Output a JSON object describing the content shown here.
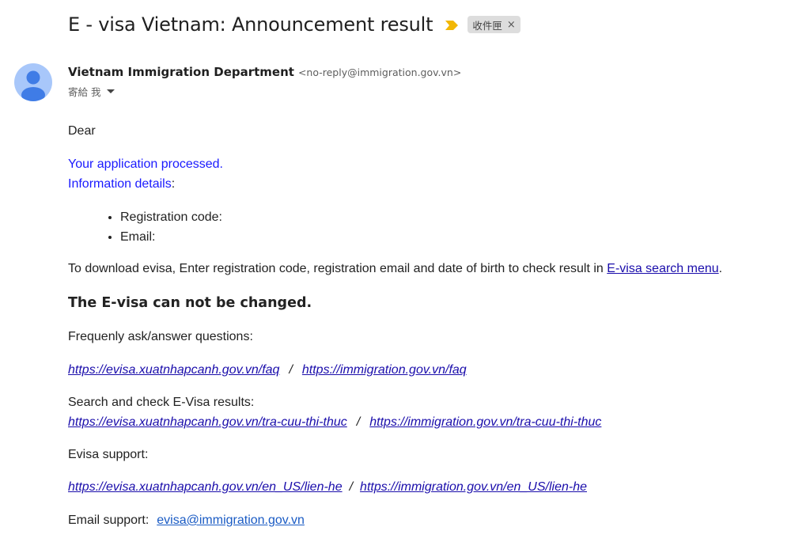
{
  "header": {
    "subject": "E - visa Vietnam: Announcement result",
    "label_chip": "收件匣",
    "label_close": "×",
    "importance_icon": "importance-marker-icon",
    "importance_color": "#f2b705"
  },
  "sender": {
    "name": "Vietnam Immigration Department",
    "email": "<no-reply@immigration.gov.vn>",
    "to": "寄給 我",
    "avatar_icon": "person-icon",
    "avatar_bg": "#a8c7fa",
    "avatar_fg": "#3f7ce6"
  },
  "message": {
    "greeting": "Dear",
    "processed": "Your application processed.",
    "info_label": "Information details",
    "info_colon": ":",
    "bullets": [
      "Registration code:",
      "Email:"
    ],
    "download_text": "To download evisa, Enter registration code, registration email and date of birth to check result in ",
    "download_link": "E-visa search menu",
    "download_end": ".",
    "warning": "The E-visa can not be changed.",
    "faq_label": "Frequenly ask/answer questions:",
    "faq_link1": "https://evisa.xuatnhapcanh.gov.vn/faq",
    "faq_sep": "/",
    "faq_link2": "https://immigration.gov.vn/faq",
    "search_label": "Search and check E-Visa results:",
    "search_link1": "https://evisa.xuatnhapcanh.gov.vn/tra-cuu-thi-thuc",
    "search_sep": "/",
    "search_link2": "https://immigration.gov.vn/tra-cuu-thi-thuc",
    "support_label": "Evisa support:",
    "support_link1": "https://evisa.xuatnhapcanh.gov.vn/en_US/lien-he",
    "support_sep": "/",
    "support_link2": "https://immigration.gov.vn/en_US/lien-he",
    "email_label": "Email support:",
    "email_link": "evisa@immigration.gov.vn"
  }
}
